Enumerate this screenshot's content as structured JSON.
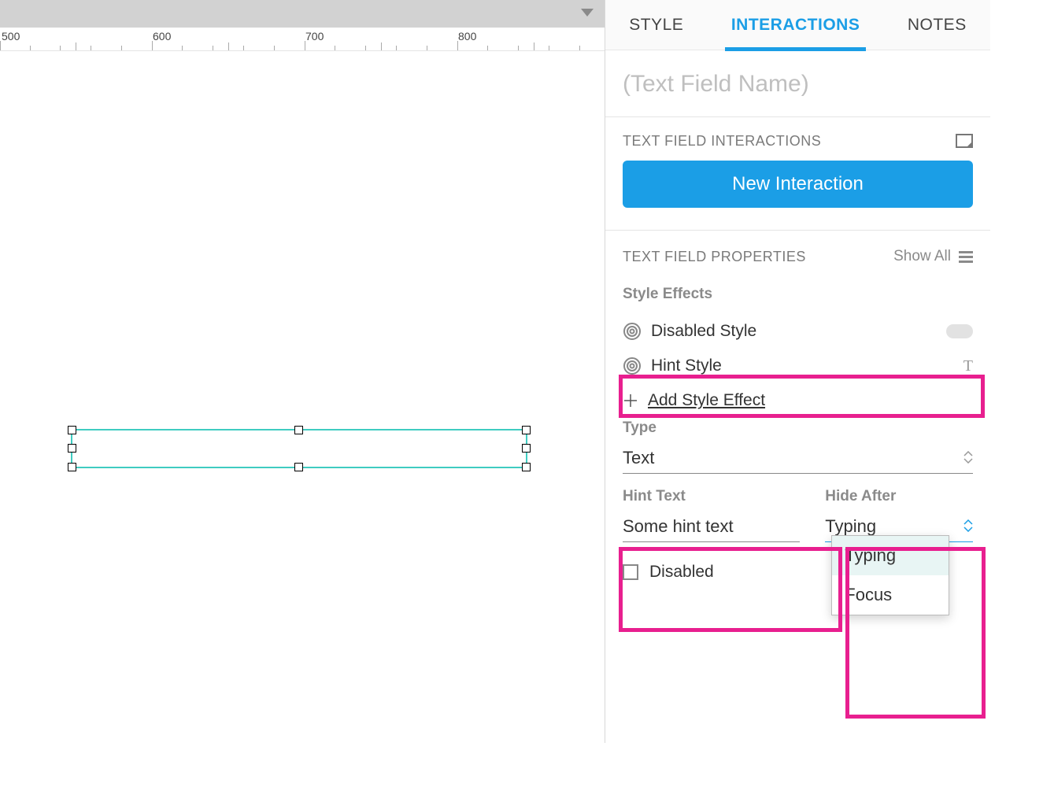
{
  "ruler": {
    "ticks": [
      "500",
      "600",
      "700",
      "800"
    ]
  },
  "panel": {
    "tabs": {
      "style": "STYLE",
      "interactions": "INTERACTIONS",
      "notes": "NOTES"
    },
    "name_placeholder": "(Text Field Name)",
    "interactions_section": "TEXT FIELD INTERACTIONS",
    "new_interaction": "New Interaction",
    "properties_section": "TEXT FIELD PROPERTIES",
    "show_all": "Show All",
    "style_effects_label": "Style Effects",
    "disabled_style": "Disabled Style",
    "hint_style": "Hint Style",
    "hint_style_badge": "T",
    "add_style_effect": "Add Style Effect",
    "type_label": "Type",
    "type_value": "Text",
    "hint_text_label": "Hint Text",
    "hint_text_value": "Some hint text",
    "hide_after_label": "Hide After",
    "hide_after_value": "Typing",
    "dropdown": {
      "opt1": "Typing",
      "opt2": "Focus"
    },
    "disabled_label": "Disabled"
  }
}
